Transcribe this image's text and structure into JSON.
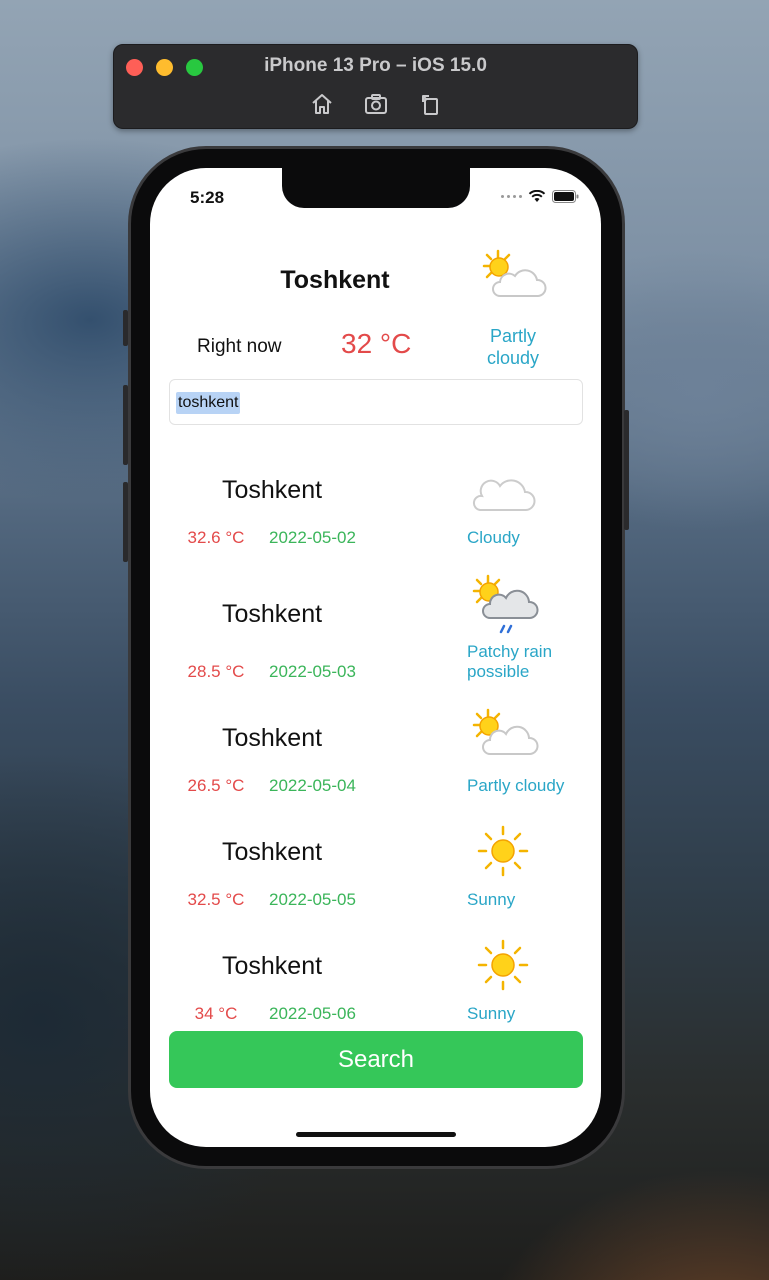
{
  "simulator": {
    "title": "iPhone 13 Pro – iOS 15.0",
    "tools": [
      "home-icon",
      "screenshot-icon",
      "rotate-icon"
    ]
  },
  "status_bar": {
    "time": "5:28",
    "icons": [
      "signal-dots-icon",
      "wifi-icon",
      "battery-icon"
    ]
  },
  "current": {
    "city": "Toshkent",
    "label": "Right now",
    "temperature": "32 °C",
    "condition": "Partly cloudy",
    "icon": "partly-cloudy-icon"
  },
  "search": {
    "value": "toshkent",
    "button_label": "Search"
  },
  "forecast": [
    {
      "city": "Toshkent",
      "temperature": "32.6 °C",
      "date": "2022-05-02",
      "condition": "Cloudy",
      "icon": "cloudy-icon"
    },
    {
      "city": "Toshkent",
      "temperature": "28.5 °C",
      "date": "2022-05-03",
      "condition": "Patchy rain possible",
      "icon": "patchy-rain-icon"
    },
    {
      "city": "Toshkent",
      "temperature": "26.5 °C",
      "date": "2022-05-04",
      "condition": "Partly cloudy",
      "icon": "partly-cloudy-icon"
    },
    {
      "city": "Toshkent",
      "temperature": "32.5 °C",
      "date": "2022-05-05",
      "condition": "Sunny",
      "icon": "sunny-icon"
    },
    {
      "city": "Toshkent",
      "temperature": "34 °C",
      "date": "2022-05-06",
      "condition": "Sunny",
      "icon": "sunny-icon"
    }
  ],
  "colors": {
    "temperature": "#e34a4a",
    "date": "#3bb55a",
    "condition": "#2aa6c7",
    "button": "#35c759"
  }
}
